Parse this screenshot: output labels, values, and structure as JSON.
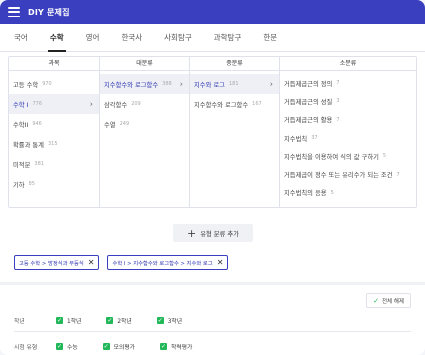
{
  "header": {
    "title": "DIY 문제집",
    "menu_icon": "hamburger-icon"
  },
  "tabs": [
    {
      "label": "국어",
      "active": false
    },
    {
      "label": "수학",
      "active": true
    },
    {
      "label": "영어",
      "active": false
    },
    {
      "label": "한국사",
      "active": false
    },
    {
      "label": "사회탐구",
      "active": false
    },
    {
      "label": "과학탐구",
      "active": false
    },
    {
      "label": "한문",
      "active": false
    }
  ],
  "table": {
    "headers": [
      "과목",
      "대분류",
      "중분류",
      "소분류"
    ],
    "subjects": [
      {
        "label": "고등 수학",
        "count": "970"
      },
      {
        "label": "수학 I",
        "count": "776"
      },
      {
        "label": "수학II",
        "count": "946"
      },
      {
        "label": "확률과 통계",
        "count": "315"
      },
      {
        "label": "미적분",
        "count": "381"
      },
      {
        "label": "기하",
        "count": "85"
      }
    ],
    "major": [
      {
        "label": "지수함수와 로그함수",
        "count": "388"
      },
      {
        "label": "삼각함수",
        "count": "209"
      },
      {
        "label": "수열",
        "count": "249"
      }
    ],
    "middle": [
      {
        "label": "지수와 로그",
        "count": "181"
      },
      {
        "label": "지수함수와 로그함수",
        "count": "167"
      }
    ],
    "minor": [
      {
        "label": "거듭제곱근의 정의",
        "count": "7"
      },
      {
        "label": "거듭제곱근의 성질",
        "count": "3"
      },
      {
        "label": "거듭제곱근의 활용",
        "count": "7"
      },
      {
        "label": "지수법칙",
        "count": "37"
      },
      {
        "label": "지수법칙을 이용하여 식의 값 구하기",
        "count": "5"
      },
      {
        "label": "거듭제곱이 정수 또는 유리수가 되는 조건",
        "count": "7"
      },
      {
        "label": "지수법칙의 응용",
        "count": "5"
      }
    ]
  },
  "add_button": {
    "label": "유형 분류 추가",
    "icon": "plus-icon"
  },
  "chips": [
    {
      "label": "고등 수학 > 방정식과 부등식"
    },
    {
      "label": "수학 I > 지수함수와 로그함수 > 지수와 로그"
    }
  ],
  "select_all": {
    "label": "전체 해제"
  },
  "filters": {
    "grade": {
      "label": "학년",
      "options": [
        "1학년",
        "2학년",
        "3학년"
      ]
    },
    "exam": {
      "label": "시험 유형",
      "options": [
        "수능",
        "모의평가",
        "학력평가"
      ]
    }
  },
  "colors": {
    "header_bg": "#3a3fbf",
    "check_green": "#22b85a",
    "chip_border": "#3a3fbf"
  }
}
